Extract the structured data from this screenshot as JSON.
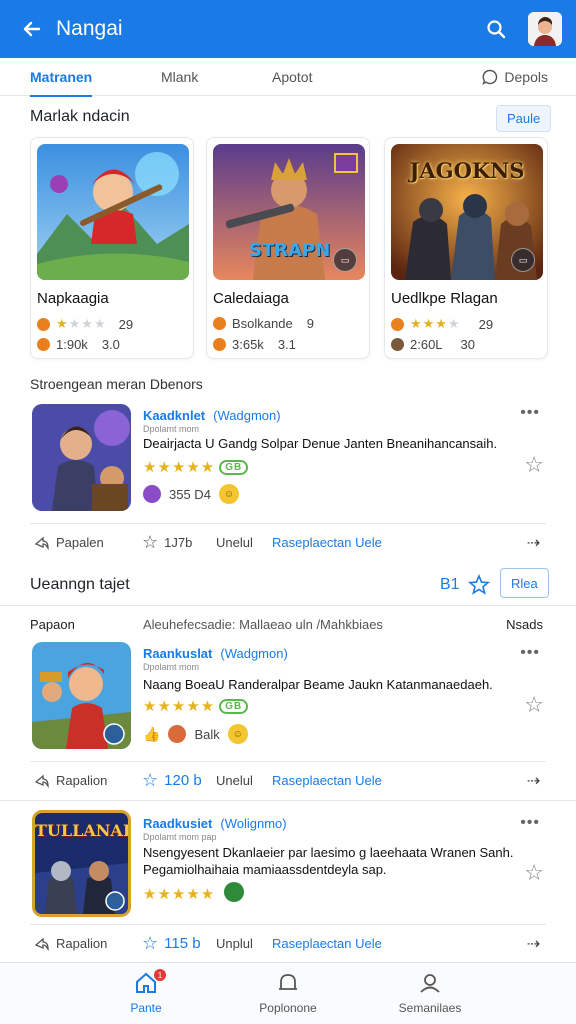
{
  "app": {
    "title": "Nangai"
  },
  "tabs": [
    {
      "label": "Matranen"
    },
    {
      "label": "Mlank"
    },
    {
      "label": "Apotot"
    },
    {
      "label": "Depols"
    }
  ],
  "featured": {
    "title": "Marlak ndacin",
    "button": "Paule",
    "cards": [
      {
        "name": "Napkaagia",
        "rating_value": "29",
        "count": "1:90k",
        "size": "3.0"
      },
      {
        "name": "Caledaiaga",
        "art_text": "STRAPN",
        "rating_value": "9",
        "rating_text": "Bsolkande",
        "count": "3:65k",
        "size": "3.1"
      },
      {
        "name": "Uedlkpe Rlagan",
        "art_text": "JAGOKNS",
        "rating_value": "29",
        "count": "2:60L",
        "size": "30"
      }
    ]
  },
  "section2": {
    "title": "Stroengean meran Dbenors"
  },
  "items": [
    {
      "name": "Kaadknlet",
      "tag": "(Wadgmon)",
      "tiny": "Dpolamt mom",
      "desc": "Deairjacta U Gandg Solpar Denue Janten Bneanihancansaih.",
      "badge": "GB",
      "meta": "355 D4",
      "actions": {
        "a1": "Papalen",
        "a2": "1J7b",
        "a3": "Unelul",
        "a4": "Raseplaectan Uele"
      }
    }
  ],
  "section3": {
    "title": "Ueanngn tajet",
    "count": "B1",
    "button": "Rlea"
  },
  "section4": {
    "left": "Papaon",
    "middle": "Aleuhefecsadie: Mallaeao uln /Mahkbiaes",
    "right": "Nsads"
  },
  "items2": [
    {
      "name": "Raankuslat",
      "tag": "(Wadgmon)",
      "tiny": "Dpolamt mom",
      "desc": "Naang BoeaU Randeralpar Beame Jaukn Katanmanaedaeh.",
      "badge": "GB",
      "meta": "Balk",
      "actions": {
        "a1": "Rapalion",
        "a2": "120 b",
        "a3": "Unelul",
        "a4": "Raseplaectan Uele"
      }
    },
    {
      "name": "Raadkusiet",
      "tag": "(Wolignmo)",
      "tiny": "Dpolamt mom pap",
      "desc": "Nsengyesent Dkanlaeier par laesimo g laeehaata Wranen Sanh. Pegamiolhaihaia mamiaassdentdeyla sap.",
      "art_text": "TULLANAI",
      "actions": {
        "a1": "Rapalion",
        "a2": "115 b",
        "a3": "Unplul",
        "a4": "Raseplaectan Uele"
      }
    }
  ],
  "nav": [
    {
      "label": "Pante",
      "badge": "1"
    },
    {
      "label": "Poplonone"
    },
    {
      "label": "Semanilaes"
    }
  ],
  "colors": {
    "primary": "#1a7be6",
    "star": "#e6b21e",
    "coin": "#e8801d",
    "green": "#58b84a"
  }
}
